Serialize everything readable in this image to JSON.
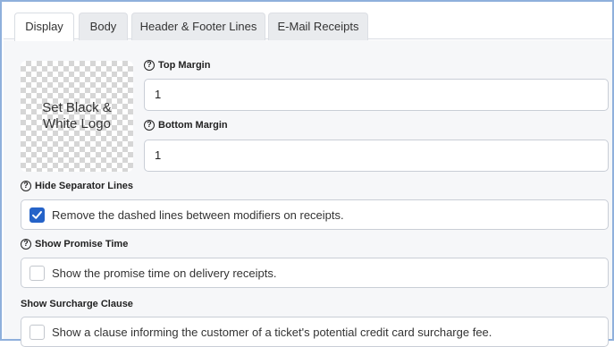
{
  "tabs": [
    {
      "label": "Display",
      "active": true
    },
    {
      "label": "Body",
      "active": false
    },
    {
      "label": "Header & Footer Lines",
      "active": false
    },
    {
      "label": "E-Mail Receipts",
      "active": false
    }
  ],
  "logo": {
    "label": "Set Black & White Logo"
  },
  "top_margin": {
    "label": "Top Margin",
    "value": "1"
  },
  "bottom_margin": {
    "label": "Bottom Margin",
    "value": "1"
  },
  "hide_separator": {
    "label": "Hide Separator Lines",
    "option": "Remove the dashed lines between modifiers on receipts.",
    "checked": true
  },
  "promise_time": {
    "label": "Show Promise Time",
    "option": "Show the promise time on delivery receipts.",
    "checked": false
  },
  "surcharge": {
    "label": "Show Surcharge Clause",
    "option": "Show a clause informing the customer of a ticket's potential credit card surcharge fee.",
    "checked": false
  },
  "icons": {
    "help": "question-circle-icon",
    "check": "checkmark-icon"
  },
  "colors": {
    "accent": "#2563c8",
    "frame_border": "#8fb0dc",
    "panel_bg": "#f6f7f9"
  }
}
